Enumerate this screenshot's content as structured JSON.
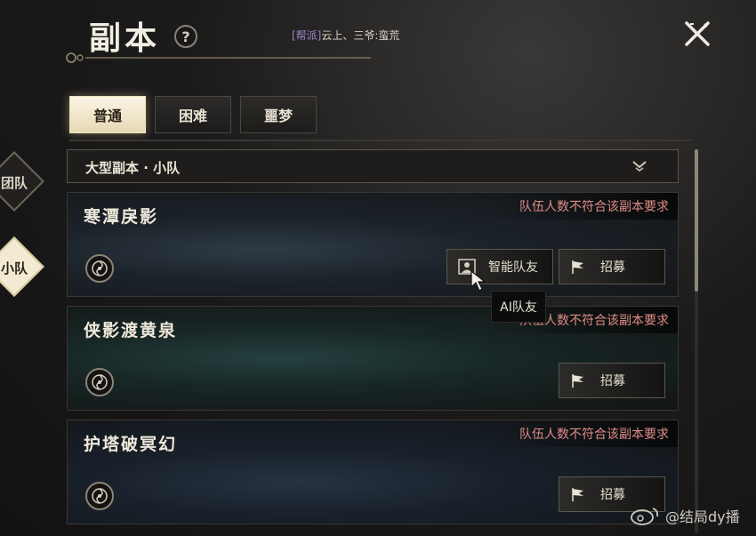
{
  "header": {
    "title": "副本",
    "help_label": "?",
    "guild_tag": "[帮派]",
    "guild_members": "云上、三爷:蛮荒"
  },
  "side_tabs": [
    {
      "label": "团队",
      "selected": false
    },
    {
      "label": "小队",
      "selected": true
    }
  ],
  "difficulty_tabs": [
    {
      "label": "普通",
      "selected": true
    },
    {
      "label": "困难",
      "selected": false
    },
    {
      "label": "噩梦",
      "selected": false
    }
  ],
  "dropdown": {
    "selected": "大型副本 · 小队"
  },
  "dungeons": [
    {
      "name": "寒潭戾影",
      "warning": "队伍人数不符合该副本要求",
      "ai_button": "智能队友",
      "recruit_button": "招募"
    },
    {
      "name": "侠影渡黄泉",
      "warning": "队伍人数不符合该副本要求",
      "recruit_button": "招募"
    },
    {
      "name": "护塔破冥幻",
      "warning": "队伍人数不符合该副本要求",
      "recruit_button": "招募"
    }
  ],
  "tooltip": {
    "text": "AI队友"
  },
  "watermark": {
    "text": "@结局dy播"
  },
  "colors": {
    "warning": "#e08c86",
    "guild_tag": "#9b87c9",
    "active_tab": "#f5ecd3"
  },
  "icons": [
    "help-icon",
    "close-icon",
    "chevron-down-icon",
    "swirl-icon",
    "ai-teammate-icon",
    "flag-icon",
    "cursor-icon",
    "weibo-icon"
  ]
}
